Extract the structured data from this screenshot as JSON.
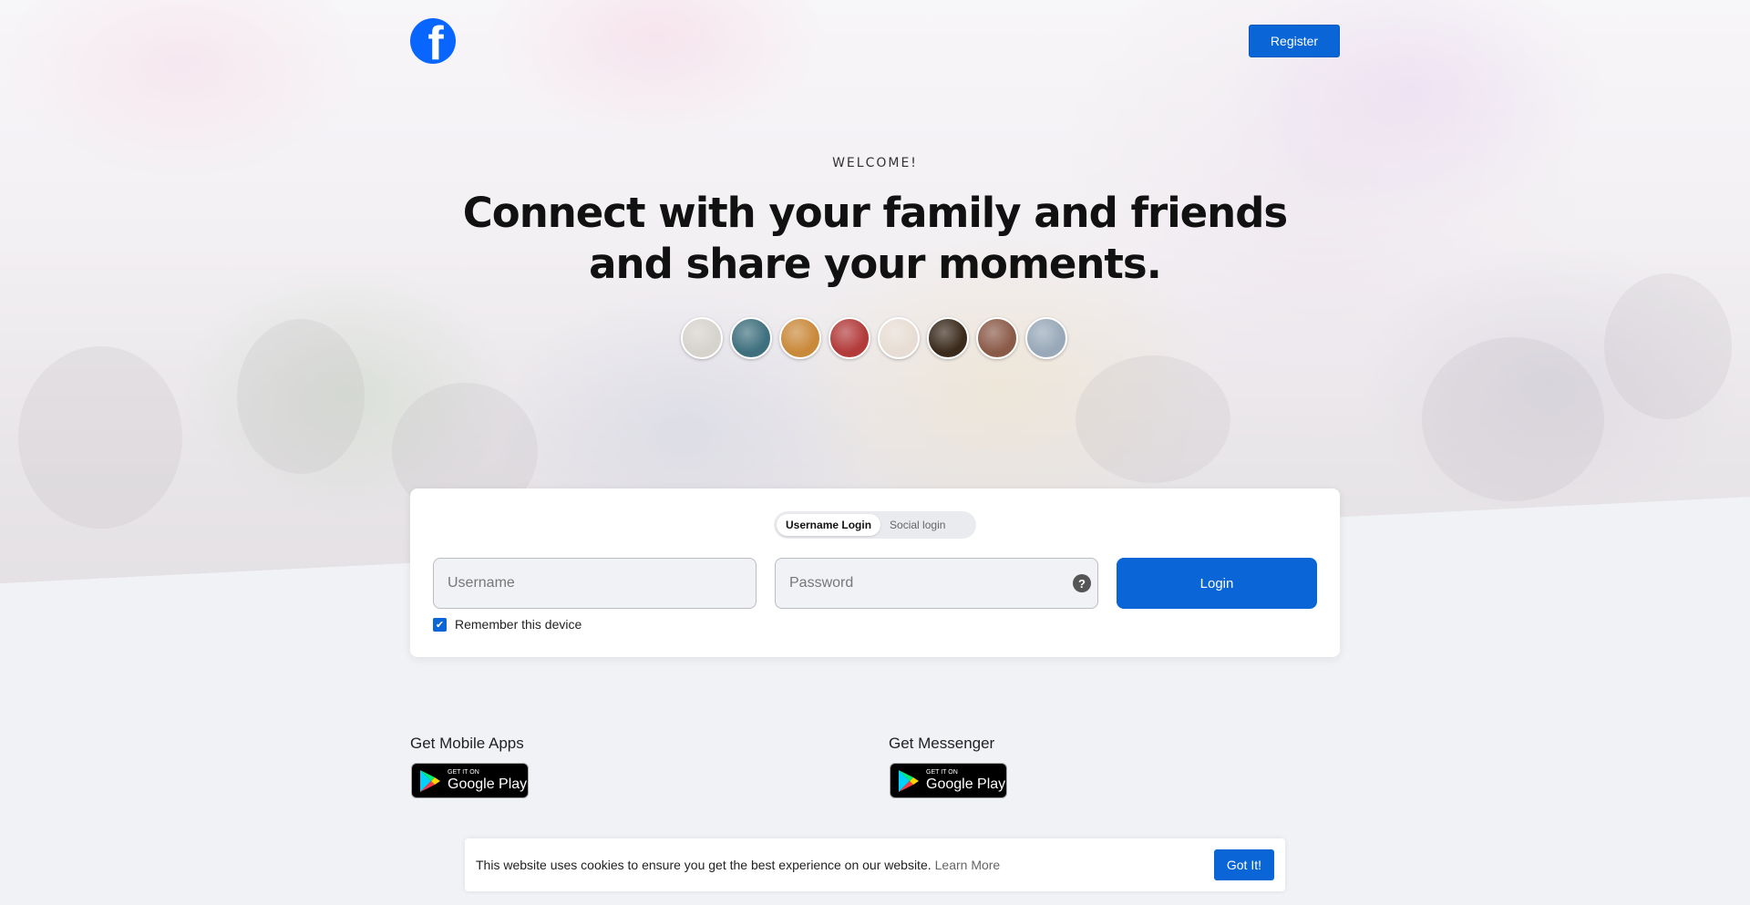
{
  "header": {
    "logo_letter": "f",
    "register_label": "Register"
  },
  "hero": {
    "welcome": "WELCOME!",
    "headline_line1": "Connect with your family and friends",
    "headline_line2": "and share your moments."
  },
  "avatars": [
    {
      "color": "#d6d2cc"
    },
    {
      "color": "#3e6f7d"
    },
    {
      "color": "#c9893a"
    },
    {
      "color": "#b23a3a"
    },
    {
      "color": "#e7ddd4"
    },
    {
      "color": "#3a2a1c"
    },
    {
      "color": "#8a5a48"
    },
    {
      "color": "#98a8b8"
    }
  ],
  "login": {
    "tabs": [
      "Username Login",
      "Social login"
    ],
    "active_tab": "Username Login",
    "username_placeholder": "Username",
    "password_placeholder": "Password",
    "help_icon": "?",
    "login_label": "Login",
    "remember_label": "Remember this device",
    "remember_checked": true
  },
  "apps": {
    "mobile_title": "Get Mobile Apps",
    "messenger_title": "Get Messenger",
    "badge_small": "GET IT ON",
    "badge_big": "Google Play"
  },
  "cookie": {
    "message": "This website uses cookies to ensure you get the best experience on our website.",
    "learn_more": "Learn More",
    "accept_label": "Got It!"
  },
  "colors": {
    "brand": "#0866ff",
    "button": "#0a66d6",
    "page_bg": "#f0f2f6"
  }
}
